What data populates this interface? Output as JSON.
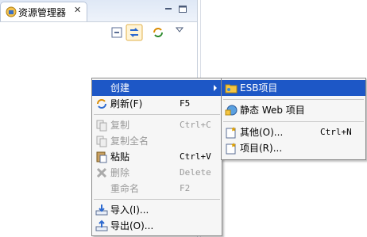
{
  "view": {
    "tab_title": "资源管理器",
    "close_glyph": "✕"
  },
  "context_menu": {
    "items": [
      {
        "label": "创建",
        "shortcut": "",
        "icon": "none",
        "enabled": true,
        "selected": true,
        "submenu": true
      },
      {
        "label": "刷新(F)",
        "shortcut": "F5",
        "icon": "refresh-icon",
        "enabled": true
      },
      {
        "label": "复制",
        "shortcut": "Ctrl+C",
        "icon": "copy-icon",
        "enabled": false
      },
      {
        "label": "复制全名",
        "shortcut": "",
        "icon": "copy-fullname-icon",
        "enabled": false
      },
      {
        "label": "粘贴",
        "shortcut": "Ctrl+V",
        "icon": "paste-icon",
        "enabled": true
      },
      {
        "label": "删除",
        "shortcut": "Delete",
        "icon": "delete-icon",
        "enabled": false
      },
      {
        "label": "重命名",
        "shortcut": "F2",
        "icon": "none",
        "enabled": false
      },
      {
        "label": "导入(I)...",
        "shortcut": "",
        "icon": "import-icon",
        "enabled": true
      },
      {
        "label": "导出(O)...",
        "shortcut": "",
        "icon": "export-icon",
        "enabled": true
      }
    ]
  },
  "submenu": {
    "items": [
      {
        "label": "ESB项目",
        "shortcut": "",
        "icon": "esb-project-icon",
        "selected": true
      },
      {
        "label": "静态 Web 项目",
        "shortcut": "",
        "icon": "static-web-project-icon"
      },
      {
        "label": "其他(O)...",
        "shortcut": "Ctrl+N",
        "icon": "other-wizard-icon"
      },
      {
        "label": "项目(R)...",
        "shortcut": "",
        "icon": "project-wizard-icon"
      }
    ]
  },
  "colors": {
    "selection": "#1d57c6",
    "menu_bg": "#f6f6f6",
    "disabled_text": "#9a9a9a"
  }
}
